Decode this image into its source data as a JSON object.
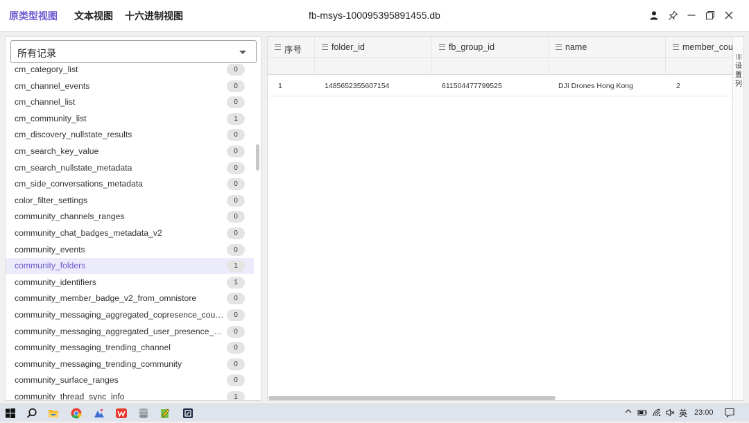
{
  "titlebar": {
    "tabs": [
      {
        "label": "原类型视图",
        "active": true
      },
      {
        "label": "文本视图",
        "active": false
      },
      {
        "label": "十六进制视图",
        "active": false
      }
    ],
    "window_title": "fb-msys-100095395891455.db",
    "accent_color": "#6d5bd0",
    "buttons": [
      "user-icon",
      "pin-icon",
      "minimize-icon",
      "restore-icon",
      "close-icon"
    ]
  },
  "left": {
    "select_value": "所有记录",
    "tables": [
      {
        "name": "cm_category_list",
        "count": "0"
      },
      {
        "name": "cm_channel_events",
        "count": "0"
      },
      {
        "name": "cm_channel_list",
        "count": "0"
      },
      {
        "name": "cm_community_list",
        "count": "1"
      },
      {
        "name": "cm_discovery_nullstate_results",
        "count": "0"
      },
      {
        "name": "cm_search_key_value",
        "count": "0"
      },
      {
        "name": "cm_search_nullstate_metadata",
        "count": "0"
      },
      {
        "name": "cm_side_conversations_metadata",
        "count": "0"
      },
      {
        "name": "color_filter_settings",
        "count": "0"
      },
      {
        "name": "community_channels_ranges",
        "count": "0"
      },
      {
        "name": "community_chat_badges_metadata_v2",
        "count": "0"
      },
      {
        "name": "community_events",
        "count": "0"
      },
      {
        "name": "community_folders",
        "count": "1",
        "selected": true
      },
      {
        "name": "community_identifiers",
        "count": "1"
      },
      {
        "name": "community_member_badge_v2_from_omnistore",
        "count": "0"
      },
      {
        "name": "community_messaging_aggregated_copresence_counts",
        "count": "0"
      },
      {
        "name": "community_messaging_aggregated_user_presence_counts",
        "count": "0"
      },
      {
        "name": "community_messaging_trending_channel",
        "count": "0"
      },
      {
        "name": "community_messaging_trending_community",
        "count": "0"
      },
      {
        "name": "community_surface_ranges",
        "count": "0"
      },
      {
        "name": "community_thread_sync_info",
        "count": "1"
      }
    ]
  },
  "grid": {
    "columns": [
      "序号",
      "folder_id",
      "fb_group_id",
      "name",
      "member_count"
    ],
    "rows": [
      [
        "1",
        "1485652355607154",
        "611504477799525",
        "DJI Drones Hong Kong",
        "2"
      ]
    ],
    "settings_label": "设置列"
  },
  "taskbar": {
    "apps": [
      "windows-start-icon",
      "search-icon",
      "file-explorer-icon",
      "chrome-icon",
      "photos-icon",
      "wps-icon",
      "database-icon",
      "notepad-icon",
      "app-icon"
    ],
    "ime": "英",
    "time": "23:00"
  }
}
